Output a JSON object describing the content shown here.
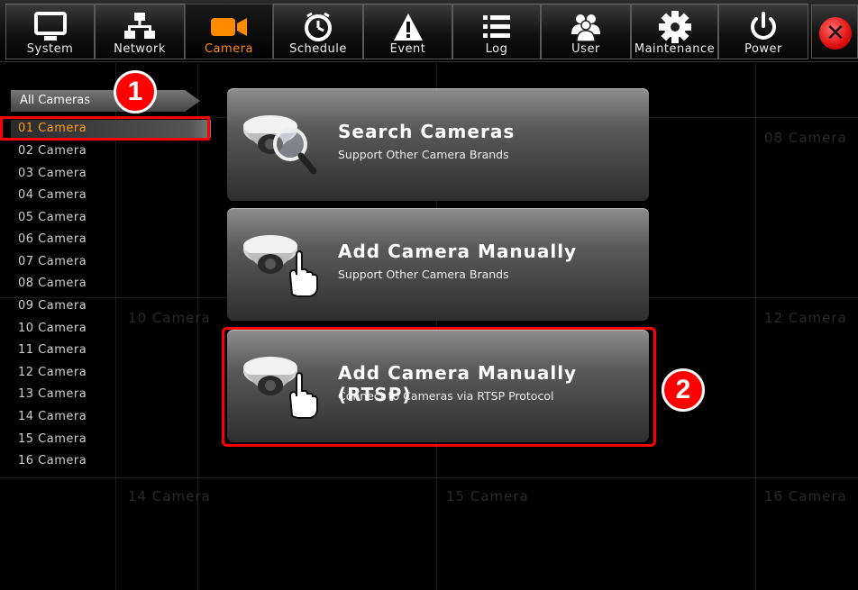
{
  "toolbar": {
    "items": [
      {
        "label": "System",
        "icon": "monitor-icon"
      },
      {
        "label": "Network",
        "icon": "network-icon"
      },
      {
        "label": "Camera",
        "icon": "camera-icon",
        "active": true
      },
      {
        "label": "Schedule",
        "icon": "clock-icon"
      },
      {
        "label": "Event",
        "icon": "warning-icon"
      },
      {
        "label": "Log",
        "icon": "list-icon"
      },
      {
        "label": "User",
        "icon": "users-icon"
      },
      {
        "label": "Maintenance",
        "icon": "gear-icon"
      },
      {
        "label": "Power",
        "icon": "power-icon"
      }
    ],
    "close_icon": "close-icon",
    "close_symbol": "✕"
  },
  "grid": {
    "labels": [
      "08 Camera",
      "10 Camera",
      "12 Camera",
      "14 Camera",
      "15 Camera",
      "16 Camera"
    ]
  },
  "camera_list": {
    "header": "All Cameras",
    "items": [
      "01 Camera",
      "02 Camera",
      "03 Camera",
      "04 Camera",
      "05 Camera",
      "06 Camera",
      "07 Camera",
      "08 Camera",
      "09 Camera",
      "10 Camera",
      "11 Camera",
      "12 Camera",
      "13 Camera",
      "14 Camera",
      "15 Camera",
      "16 Camera"
    ],
    "selected_index": 0
  },
  "options": [
    {
      "title": "Search Cameras",
      "subtitle": "Support Other Camera Brands",
      "icon": "search-camera-icon"
    },
    {
      "title": "Add Camera Manually",
      "subtitle": "Support Other Camera Brands",
      "icon": "hand-camera-icon"
    },
    {
      "title": "Add Camera Manually (RTSP)",
      "subtitle": "Connect to Cameras via RTSP Protocol",
      "icon": "hand-camera-icon"
    }
  ],
  "badges": {
    "step1": "1",
    "step2": "2"
  },
  "colors": {
    "accent": "#ff8c00",
    "highlight": "#ff0000"
  }
}
